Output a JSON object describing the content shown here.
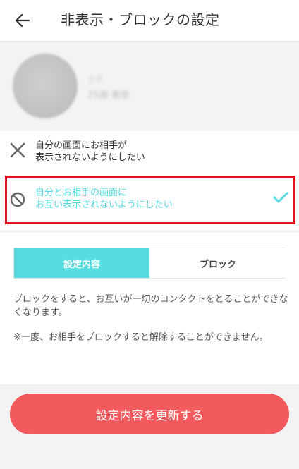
{
  "header": {
    "title": "非表示・ブロックの設定",
    "back_icon": "arrow-left-icon"
  },
  "profile": {
    "name": "さき",
    "subtitle": "25歳 東京"
  },
  "options": [
    {
      "icon": "x-icon",
      "label_line1": "自分の画面にお相手が",
      "label_line2": "表示されないようにしたい",
      "selected": false
    },
    {
      "icon": "block-icon",
      "label_line1": "自分とお相手の画面に",
      "label_line2": "お互い表示されないようにしたい",
      "selected": true
    }
  ],
  "tabs": [
    {
      "label": "設定内容",
      "active": true
    },
    {
      "label": "ブロック",
      "active": false
    }
  ],
  "description": {
    "text1": "ブロックをすると、お互いが一切のコンタクトをとることができなくなります。",
    "text2": "※一度、お相手をブロックすると解除することができません。"
  },
  "submit_button": {
    "label": "設定内容を更新する"
  },
  "colors": {
    "accent": "#57dce0",
    "selected_text": "#4fd8df",
    "highlight_border": "#e0141e",
    "button": "#f25a5e"
  }
}
